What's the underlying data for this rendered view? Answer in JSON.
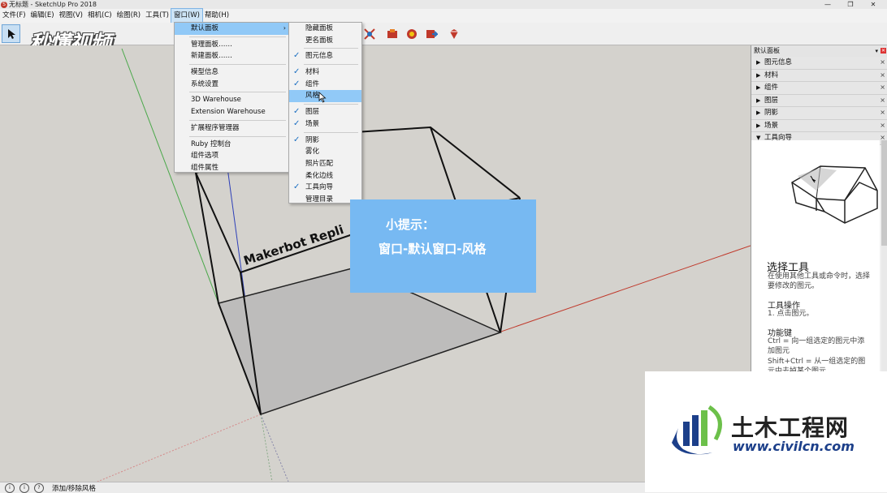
{
  "window": {
    "title": "无标题 - SketchUp Pro 2018"
  },
  "menubar": [
    "文件(F)",
    "编辑(E)",
    "视图(V)",
    "相机(C)",
    "绘图(R)",
    "工具(T)",
    "窗口(W)",
    "帮助(H)"
  ],
  "window_menu": {
    "items": [
      {
        "label": "默认面板",
        "submenu": true
      },
      {
        "label": "管理面板……"
      },
      {
        "label": "新建面板……"
      },
      {
        "label": "模型信息"
      },
      {
        "label": "系统设置"
      },
      {
        "label": "3D Warehouse"
      },
      {
        "label": "Extension Warehouse"
      },
      {
        "label": "扩展程序管理器"
      },
      {
        "label": "Ruby 控制台"
      },
      {
        "label": "组件选项"
      },
      {
        "label": "组件属性"
      }
    ]
  },
  "default_tray_submenu": {
    "items": [
      {
        "label": "隐藏面板",
        "checked": false
      },
      {
        "label": "更名面板",
        "checked": false
      },
      {
        "label": "图元信息",
        "checked": true
      },
      {
        "label": "材料",
        "checked": true
      },
      {
        "label": "组件",
        "checked": true
      },
      {
        "label": "风格",
        "checked": false,
        "highlighted": true
      },
      {
        "label": "图层",
        "checked": true
      },
      {
        "label": "场景",
        "checked": true
      },
      {
        "label": "阴影",
        "checked": true
      },
      {
        "label": "雾化",
        "checked": false
      },
      {
        "label": "照片匹配",
        "checked": false
      },
      {
        "label": "柔化边线",
        "checked": false
      },
      {
        "label": "工具向导",
        "checked": true
      },
      {
        "label": "管理目录",
        "checked": false
      }
    ]
  },
  "viewport": {
    "model_text": "Makerbot Repli"
  },
  "tip": {
    "title": "小提示：",
    "body": "窗口-默认窗口-风格"
  },
  "tray": {
    "title": "默认面板",
    "panels": [
      "图元信息",
      "材料",
      "组件",
      "图层",
      "阴影",
      "场景",
      "工具向导"
    ],
    "instructor": {
      "tool_title": "选择工具",
      "tool_desc": "在使用其他工具或命令时，选择要修改的图元。",
      "operation_head": "工具操作",
      "operation_text": "1. 点击图元。",
      "keys_head": "功能键",
      "keys_text_1": "Ctrl = 向一组选定的图元中添加图元",
      "keys_text_2": "Shift+Ctrl = 从一组选定的图元中去掉某个图元"
    }
  },
  "status": {
    "text": "添加/移除风格"
  },
  "watermarks": {
    "video_logo": "秒懂视频",
    "site_name": "土木工程网",
    "site_url": "www.civilcn.com"
  }
}
